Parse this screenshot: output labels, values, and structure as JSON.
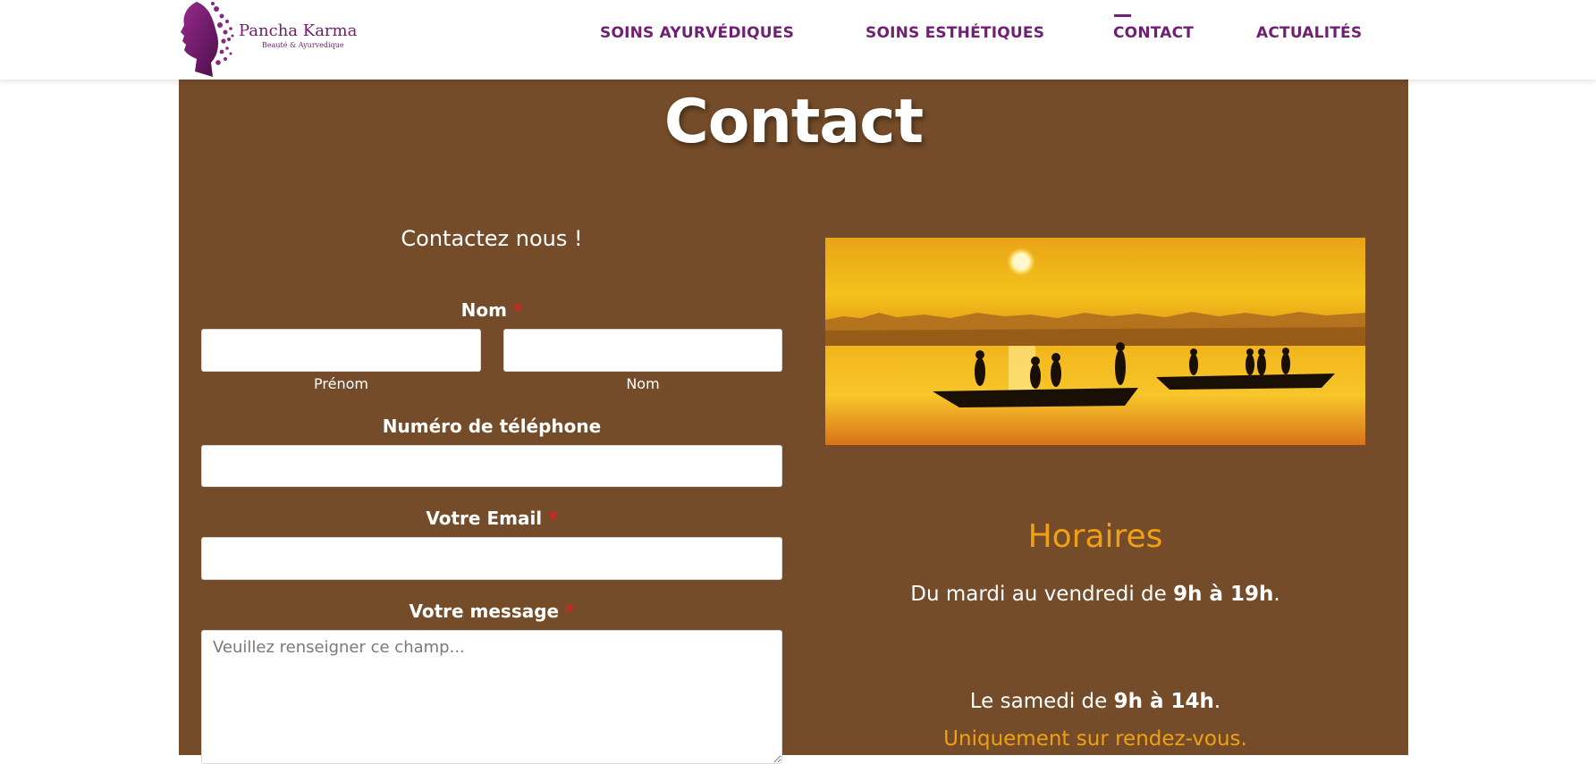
{
  "brand": {
    "name": "Pancha Karma",
    "tagline": "Beauté & Ayurvedique",
    "logo_icon": "woman-profile-silhouette-icon",
    "colors": {
      "primary": "#6f1f74",
      "panel": "#744c29",
      "accent": "#f0a012",
      "required": "#e02020"
    }
  },
  "nav": {
    "items": [
      {
        "label": "SOINS AYURVÉDIQUES"
      },
      {
        "label": "SOINS ESTHÉTIQUES"
      },
      {
        "label": "CONTACT",
        "active": true
      },
      {
        "label": "ACTUALITÉS"
      }
    ]
  },
  "page": {
    "title": "Contact"
  },
  "form": {
    "heading": "Contactez nous !",
    "required_mark": "*",
    "name": {
      "label": "Nom",
      "first_sublabel": "Prénom",
      "last_sublabel": "Nom",
      "first_value": "",
      "last_value": ""
    },
    "phone": {
      "label": "Numéro de téléphone",
      "value": ""
    },
    "email": {
      "label": "Votre Email",
      "value": ""
    },
    "message": {
      "label": "Votre message",
      "placeholder": "Veuillez renseigner ce champ...",
      "value": ""
    }
  },
  "hours": {
    "photo_icon": "sunset-river-boats-photo",
    "title": "Horaires",
    "weekday_prefix": "Du mardi au vendredi de ",
    "weekday_time": "9h à 19h",
    "weekday_suffix": ".",
    "saturday_prefix": "Le samedi de ",
    "saturday_time": "9h à 14h",
    "saturday_suffix": ".",
    "note": "Uniquement sur rendez-vous."
  }
}
